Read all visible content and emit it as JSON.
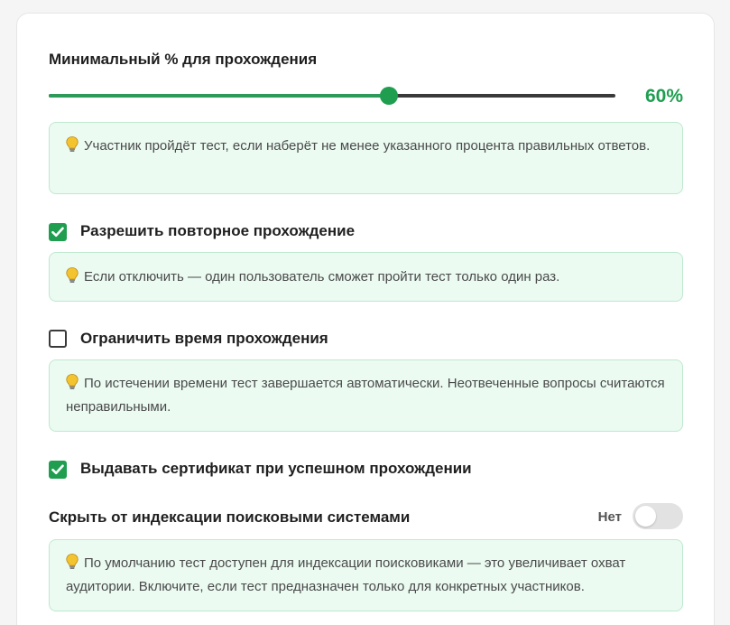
{
  "min_percent": {
    "label": "Минимальный % для прохождения",
    "value": 60,
    "value_text": "60%",
    "hint": "Участник пройдёт тест, если наберёт не менее указанного процента правильных ответов."
  },
  "allow_retake": {
    "label": "Разрешить повторное прохождение",
    "checked": true,
    "hint": "Если отключить — один пользователь сможет пройти тест только один раз."
  },
  "limit_time": {
    "label": "Ограничить время прохождения",
    "checked": false,
    "hint": "По истечении времени тест завершается автоматически. Неотвеченные вопросы считаются неправильными."
  },
  "certificate": {
    "label": "Выдавать сертификат при успешном прохождении",
    "checked": true
  },
  "hide_indexing": {
    "label": "Скрыть от индексации поисковыми системами",
    "toggle_text": "Нет",
    "enabled": false,
    "hint": "По умолчанию тест доступен для индексации поисковиками — это увеличивает охват аудитории. Включите, если тест предназначен только для конкретных участников."
  },
  "icons": {
    "hint": "lightbulb-icon",
    "check": "checkmark-icon"
  },
  "colors": {
    "accent": "#1f9e50",
    "hint_bg": "#ebfbf2",
    "hint_border": "#bfe8d0"
  }
}
